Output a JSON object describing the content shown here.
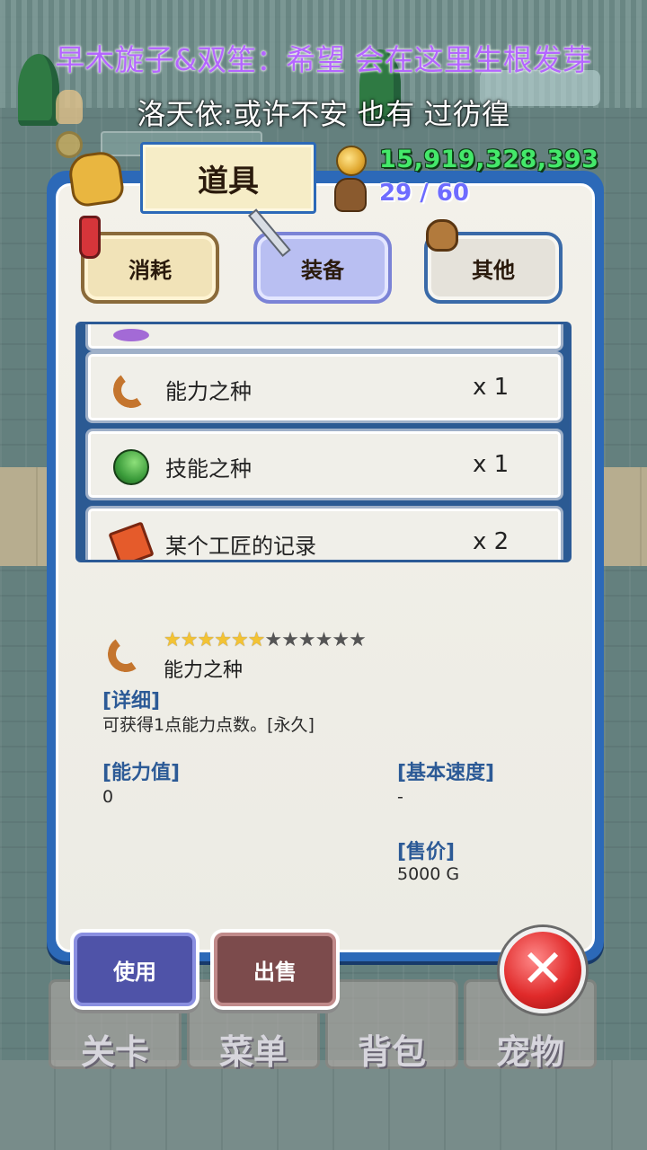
{
  "captions": {
    "line1": "早木旋子&双笙：希望 会在这里生根发芽",
    "line2": "洛天依:或许不安 也有 过彷徨"
  },
  "status": {
    "gold": "15,919,328,393",
    "capacity": "29 / 60"
  },
  "panel": {
    "title": "道具"
  },
  "tabs": [
    {
      "label": "消耗",
      "icon": "potion-icon"
    },
    {
      "label": "装备",
      "icon": "sword-icon",
      "selected": true
    },
    {
      "label": "其他",
      "icon": "sack-icon"
    }
  ],
  "items": [
    {
      "name": "",
      "qty": "",
      "icon": "purple-item-icon"
    },
    {
      "name": "能力之种",
      "qty": "x 1",
      "icon": "ability-seed-icon"
    },
    {
      "name": "技能之种",
      "qty": "x 1",
      "icon": "skill-seed-icon"
    },
    {
      "name": "某个工匠的记录",
      "qty": "x 2",
      "icon": "book-icon"
    }
  ],
  "detail": {
    "name": "能力之种",
    "rating": 6,
    "rating_max": 12,
    "detail_label": "[详细]",
    "detail_text": "可获得1点能力点数。[永久]",
    "ability_label": "[能力值]",
    "ability_value": "0",
    "speed_label": "[基本速度]",
    "speed_value": "-",
    "price_label": "[售价]",
    "price_value": "5000 G"
  },
  "actions": {
    "use": "使用",
    "sell": "出售",
    "close": "✕"
  },
  "nav": [
    "关卡",
    "菜单",
    "背包",
    "宠物"
  ],
  "colors": {
    "panel_border": "#2c69b8",
    "gold_text": "#44e86a",
    "capacity_text": "#6e6cff",
    "caption_purple": "#b466ff"
  }
}
